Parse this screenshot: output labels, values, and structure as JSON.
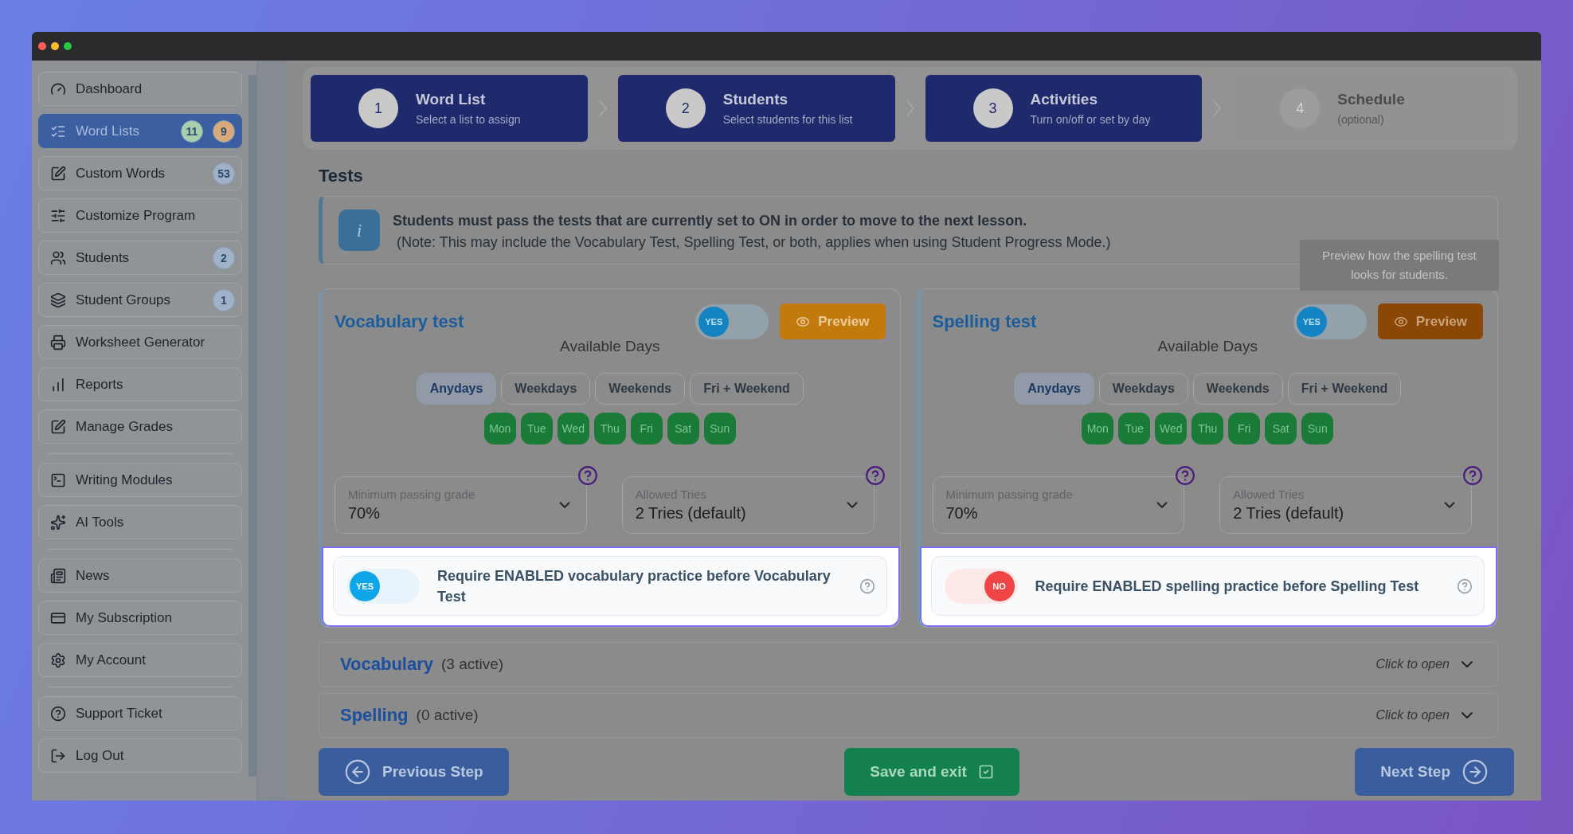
{
  "sidebar": {
    "groups": [
      {
        "items": [
          {
            "label": "Dashboard",
            "selected": false
          },
          {
            "label": "Word Lists",
            "selected": true,
            "badges": [
              {
                "text": "11",
                "color": "#a7cfae"
              },
              {
                "text": "9",
                "color": "#d9a97a"
              }
            ]
          },
          {
            "label": "Custom Words",
            "selected": false,
            "badges": [
              {
                "text": "53",
                "color": "#9fb2c8"
              }
            ]
          },
          {
            "label": "Customize Program",
            "selected": false
          },
          {
            "label": "Students",
            "selected": false,
            "badges": [
              {
                "text": "2",
                "color": "#9fb2c8"
              }
            ]
          },
          {
            "label": "Student Groups",
            "selected": false,
            "badges": [
              {
                "text": "1",
                "color": "#9fb2c8"
              }
            ]
          },
          {
            "label": "Worksheet Generator",
            "selected": false
          },
          {
            "label": "Reports",
            "selected": false
          },
          {
            "label": "Manage Grades",
            "selected": false
          }
        ]
      },
      {
        "items": [
          {
            "label": "Writing Modules",
            "selected": false
          },
          {
            "label": "AI Tools",
            "selected": false
          }
        ]
      },
      {
        "items": [
          {
            "label": "News",
            "selected": false
          },
          {
            "label": "My Subscription",
            "selected": false
          },
          {
            "label": "My Account",
            "selected": false
          }
        ]
      },
      {
        "items": [
          {
            "label": "Support Ticket",
            "selected": false
          },
          {
            "label": "Log Out",
            "selected": false
          }
        ]
      }
    ]
  },
  "steps": [
    {
      "number": "1",
      "title": "Word List",
      "subtitle": "Select a list to assign",
      "done": true
    },
    {
      "number": "2",
      "title": "Students",
      "subtitle": "Select students for this list",
      "done": true
    },
    {
      "number": "3",
      "title": "Activities",
      "subtitle": "Turn on/off or set by day",
      "done": true
    },
    {
      "number": "4",
      "title": "Schedule",
      "subtitle": "(optional)",
      "done": false
    }
  ],
  "section_title": "Tests",
  "info": {
    "badge": "i",
    "text": "Students must pass the tests that are currently set to ON in order to move to the next lesson.",
    "note": "(Note: This may include the Vocabulary Test, Spelling Test, or both, applies when using Student Progress Mode.)"
  },
  "tests": [
    {
      "title": "Vocabulary test",
      "toggle": {
        "label": "YES",
        "on": true
      },
      "preview": "Preview",
      "preview_hover": false,
      "days_title": "Available Days",
      "presets": [
        {
          "label": "Anydays",
          "selected": true
        },
        {
          "label": "Weekdays",
          "selected": false
        },
        {
          "label": "Weekends",
          "selected": false
        },
        {
          "label": "Fri + Weekend",
          "selected": false
        }
      ],
      "days": [
        {
          "label": "Mon",
          "on": true
        },
        {
          "label": "Tue",
          "on": true
        },
        {
          "label": "Wed",
          "on": true
        },
        {
          "label": "Thu",
          "on": true
        },
        {
          "label": "Fri",
          "on": true
        },
        {
          "label": "Sat",
          "on": true
        },
        {
          "label": "Sun",
          "on": true
        }
      ],
      "selects": [
        {
          "label": "Minimum passing grade",
          "value": "70%"
        },
        {
          "label": "Allowed Tries",
          "value": "2 Tries (default)"
        }
      ],
      "requirement": {
        "label": "Require ENABLED vocabulary practice before Vocabulary Test",
        "toggle": {
          "label": "YES",
          "on": true
        }
      }
    },
    {
      "title": "Spelling test",
      "toggle": {
        "label": "YES",
        "on": true
      },
      "preview": "Preview",
      "preview_hover": true,
      "tooltip": "Preview how the spelling test looks for students.",
      "days_title": "Available Days",
      "presets": [
        {
          "label": "Anydays",
          "selected": true
        },
        {
          "label": "Weekdays",
          "selected": false
        },
        {
          "label": "Weekends",
          "selected": false
        },
        {
          "label": "Fri + Weekend",
          "selected": false
        }
      ],
      "days": [
        {
          "label": "Mon",
          "on": true
        },
        {
          "label": "Tue",
          "on": true
        },
        {
          "label": "Wed",
          "on": true
        },
        {
          "label": "Thu",
          "on": true
        },
        {
          "label": "Fri",
          "on": true
        },
        {
          "label": "Sat",
          "on": true
        },
        {
          "label": "Sun",
          "on": true
        }
      ],
      "selects": [
        {
          "label": "Minimum passing grade",
          "value": "70%"
        },
        {
          "label": "Allowed Tries",
          "value": "2 Tries (default)"
        }
      ],
      "requirement": {
        "label": "Require ENABLED spelling practice before Spelling Test",
        "toggle": {
          "label": "NO",
          "on": false
        }
      }
    }
  ],
  "accordions": [
    {
      "title": "Vocabulary",
      "count": "(3 active)",
      "hint": "Click to open",
      "expanded": false
    },
    {
      "title": "Spelling",
      "count": "(0 active)",
      "hint": "Click to open",
      "expanded": false
    }
  ],
  "footer": {
    "previous": "Previous Step",
    "save": "Save and exit",
    "next": "Next Step"
  }
}
